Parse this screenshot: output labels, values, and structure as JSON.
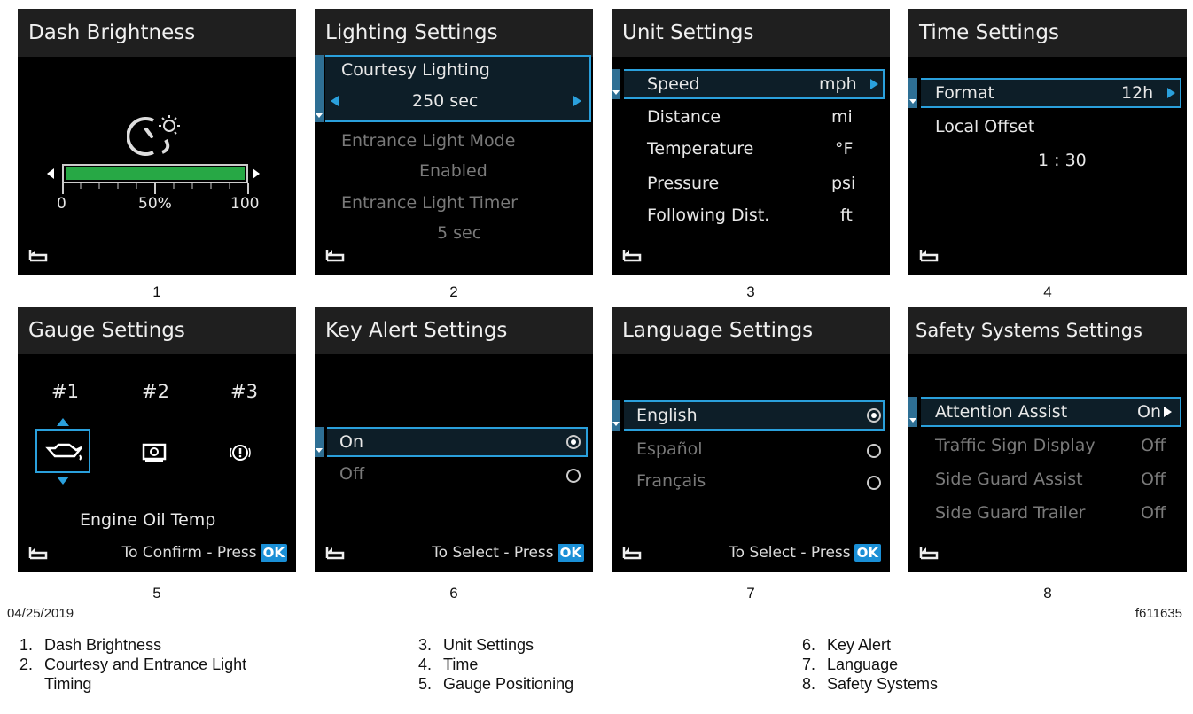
{
  "colors": {
    "accent": "#2aa0dc",
    "panel": "#000000",
    "title_bg": "#1f1f1f",
    "brightness_bar": "#27a845",
    "ok_badge": "#1a8fd6"
  },
  "screens": [
    {
      "number": "1",
      "title": "Dash Brightness",
      "icon": "dash-brightness-icon",
      "slider": {
        "min_label": "0",
        "mid_label": "50%",
        "max_label": "100",
        "level_percent": 100
      }
    },
    {
      "number": "2",
      "title": "Lighting Settings",
      "items": [
        {
          "label": "Courtesy Lighting",
          "value": "250 sec",
          "selected": true
        },
        {
          "label": "Entrance Light Mode",
          "value": "Enabled",
          "selected": false
        },
        {
          "label": "Entrance Light Timer",
          "value": "5 sec",
          "selected": false
        }
      ]
    },
    {
      "number": "3",
      "title": "Unit Settings",
      "items": [
        {
          "label": "Speed",
          "value": "mph",
          "selected": true
        },
        {
          "label": "Distance",
          "value": "mi"
        },
        {
          "label": "Temperature",
          "value": "°F"
        },
        {
          "label": "Pressure",
          "value": "psi"
        },
        {
          "label": "Following Dist.",
          "value": "ft"
        }
      ]
    },
    {
      "number": "4",
      "title": "Time Settings",
      "items": [
        {
          "label": "Format",
          "value": "12h",
          "selected": true
        },
        {
          "label": "Local Offset",
          "value": "1 : 30"
        }
      ]
    },
    {
      "number": "5",
      "title": "Gauge Settings",
      "slots": [
        "#1",
        "#2",
        "#3"
      ],
      "gauge_name": "Engine Oil Temp",
      "footer": "To Confirm - Press",
      "ok": "OK"
    },
    {
      "number": "6",
      "title": "Key Alert Settings",
      "options": [
        {
          "label": "On",
          "checked": true
        },
        {
          "label": "Off",
          "checked": false
        }
      ],
      "footer": "To Select - Press",
      "ok": "OK"
    },
    {
      "number": "7",
      "title": "Language Settings",
      "options": [
        {
          "label": "English",
          "checked": true
        },
        {
          "label": "Español",
          "checked": false
        },
        {
          "label": "Français",
          "checked": false
        }
      ],
      "footer": "To Select - Press",
      "ok": "OK"
    },
    {
      "number": "8",
      "title": "Safety Systems Settings",
      "items": [
        {
          "label": "Attention Assist",
          "value": "On",
          "selected": true
        },
        {
          "label": "Traffic Sign Display",
          "value": "Off"
        },
        {
          "label": "Side Guard Assist",
          "value": "Off"
        },
        {
          "label": "Side Guard Trailer",
          "value": "Off"
        }
      ]
    }
  ],
  "date": "04/25/2019",
  "figure_id": "f611635",
  "legend": [
    {
      "n": "1.",
      "text": "Dash Brightness"
    },
    {
      "n": "2.",
      "text": "Courtesy and Entrance Light",
      "text2": "Timing"
    },
    {
      "n": "3.",
      "text": "Unit Settings"
    },
    {
      "n": "4.",
      "text": "Time"
    },
    {
      "n": "5.",
      "text": "Gauge Positioning"
    },
    {
      "n": "6.",
      "text": "Key Alert"
    },
    {
      "n": "7.",
      "text": "Language"
    },
    {
      "n": "8.",
      "text": "Safety Systems"
    }
  ]
}
